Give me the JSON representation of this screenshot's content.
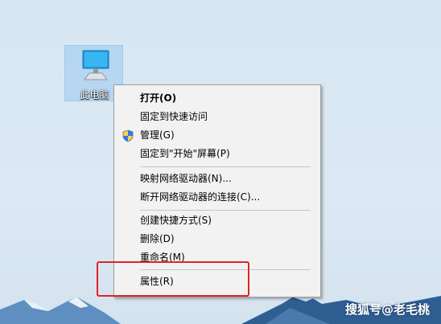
{
  "desktop": {
    "icon_label": "此电脑"
  },
  "context_menu": {
    "items": [
      {
        "label": "打开(O)"
      },
      {
        "label": "固定到快速访问"
      },
      {
        "label": "管理(G)",
        "icon": "shield-icon"
      },
      {
        "label": "固定到\"开始\"屏幕(P)"
      },
      {
        "label": "映射网络驱动器(N)..."
      },
      {
        "label": "断开网络驱动器的连接(C)..."
      },
      {
        "label": "创建快捷方式(S)"
      },
      {
        "label": "删除(D)"
      },
      {
        "label": "重命名(M)"
      },
      {
        "label": "属性(R)"
      }
    ]
  },
  "colors": {
    "highlight_box": "#e0232b",
    "menu_bg": "#f2f2f2",
    "selection": "#99c9ef"
  },
  "watermark": "搜狐号@老毛桃"
}
